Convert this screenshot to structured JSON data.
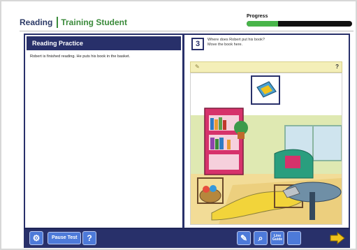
{
  "header": {
    "app_title": "Reading",
    "student_name": "Training Student",
    "progress_label": "Progress",
    "progress_fraction": 0.3
  },
  "left_panel": {
    "title": "Reading Practice",
    "passage": "Robert is finished reading. He puts his book in the basket."
  },
  "question": {
    "number": "3",
    "text_line1": "Where does Robert put his book?",
    "text_line2": "Move the book here."
  },
  "toolbar": {
    "pause_label": "Pause Test",
    "help_label": "?",
    "line_guide_line1": "Line",
    "line_guide_line2": "Guide"
  },
  "colors": {
    "navy": "#28306a",
    "green": "#3a8a3a",
    "progress": "#48b54a",
    "button": "#4d7ad9",
    "accent_yellow": "#f0c21b"
  },
  "icons": {
    "settings": "gear-icon",
    "highlighter": "pencil-icon",
    "magnifier": "magnifier-icon",
    "next": "next-arrow-icon",
    "note": "pencil-icon"
  }
}
